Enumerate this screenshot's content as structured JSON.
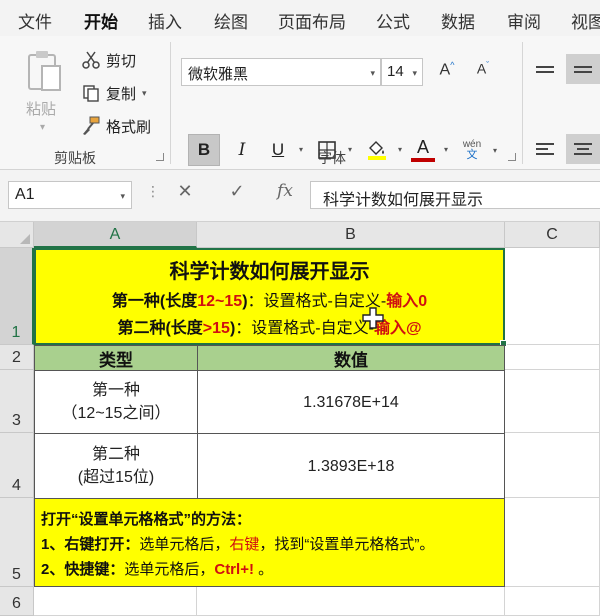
{
  "ribbon_tabs": [
    "文件",
    "开始",
    "插入",
    "绘图",
    "页面布局",
    "公式",
    "数据",
    "审阅",
    "视图"
  ],
  "clipboard": {
    "paste": "粘贴",
    "cut": "剪切",
    "copy": "复制",
    "format_painter": "格式刷",
    "group_label": "剪贴板"
  },
  "font": {
    "name": "微软雅黑",
    "size": "14",
    "grow": "A",
    "shrink": "A",
    "bold": "B",
    "italic": "I",
    "underline": "U",
    "font_color_glyph": "A",
    "phonetic_top": "wén",
    "phonetic_bottom": "文",
    "group_label": "字体",
    "highlight_color": "#ffff00",
    "font_color": "#c00000"
  },
  "formula_bar": {
    "name_box": "A1",
    "cancel": "✕",
    "enter": "✓",
    "fx": "fx",
    "content": "科学计数如何展开显示"
  },
  "columns": [
    "A",
    "B",
    "C"
  ],
  "rows": [
    "1",
    "2",
    "3",
    "4",
    "5",
    "6"
  ],
  "sheet": {
    "title": "科学计数如何展开显示",
    "line1": {
      "a": "第一种(长度",
      "b": "12~15",
      "c": ")",
      "d": "：设置格式-自定义-",
      "e": "输入0"
    },
    "line2": {
      "a": "第二种(长度",
      "b": ">15",
      "c": ")",
      "d": "：设置格式-自定义-",
      "e": "输入@"
    },
    "header_type": "类型",
    "header_value": "数值",
    "row3": {
      "type_line1": "第一种",
      "type_line2": "（12~15之间）",
      "value": "1.31678E+14"
    },
    "row4": {
      "type_line1": "第二种",
      "type_line2": "(超过15位)",
      "value": "1.3893E+18"
    },
    "note": {
      "title": "打开“设置单元格格式”的方法：",
      "line1_a": "1、右键打开：",
      "line1_b": "选单元格后，",
      "line1_c": "右键",
      "line1_d": "，找到“设置单元格格式”。",
      "line2_a": "2、快捷键：",
      "line2_b": "选单元格后，",
      "line2_c": "Ctrl+!",
      "line2_d": " 。"
    }
  },
  "colors": {
    "accent": "#217346",
    "yellow_fill": "#ffff00",
    "header_green": "#a9d08e",
    "emphasis_red": "#d01010"
  }
}
